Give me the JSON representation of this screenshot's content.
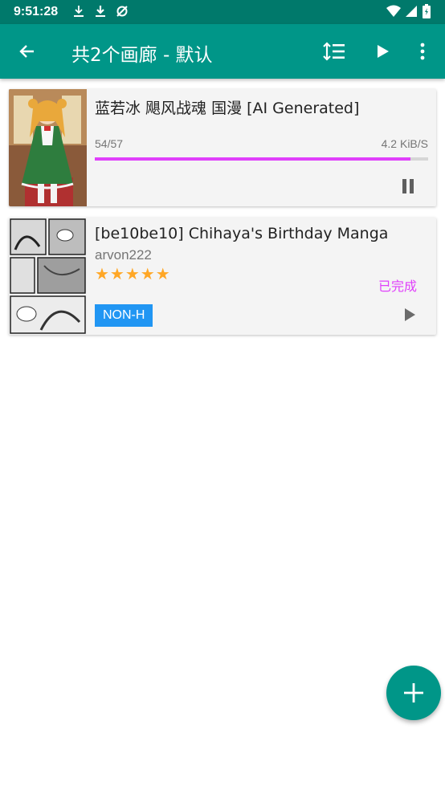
{
  "status_bar": {
    "time": "9:51:28",
    "icons": [
      "download-icon",
      "download-icon",
      "sync-off-icon",
      "wifi-icon",
      "signal-icon",
      "battery-icon"
    ]
  },
  "app_bar": {
    "title": "共2个画廊 - 默认",
    "back_icon": "arrow-left-icon",
    "actions": [
      "sort-icon",
      "play-icon",
      "more-vert-icon"
    ]
  },
  "downloads": [
    {
      "title": "蓝若冰 飓风战魂 国漫 [AI Generated]",
      "progress_text": "54/57",
      "speed": "4.2 KiB/S",
      "progress": 0.947,
      "action_icon": "pause-icon"
    },
    {
      "title": "[be10be10] Chihaya's Birthday Manga",
      "uploader": "arvon222",
      "rating": 5,
      "stars": "★★★★★",
      "state": "已完成",
      "category": "NON-H",
      "action_icon": "play-icon"
    }
  ],
  "fab": {
    "icon": "plus-icon"
  },
  "colors": {
    "primary": "#009688",
    "primary_dark": "#00796b",
    "accent": "#e040fb",
    "star": "#ffa726",
    "badge": "#2196f3"
  }
}
